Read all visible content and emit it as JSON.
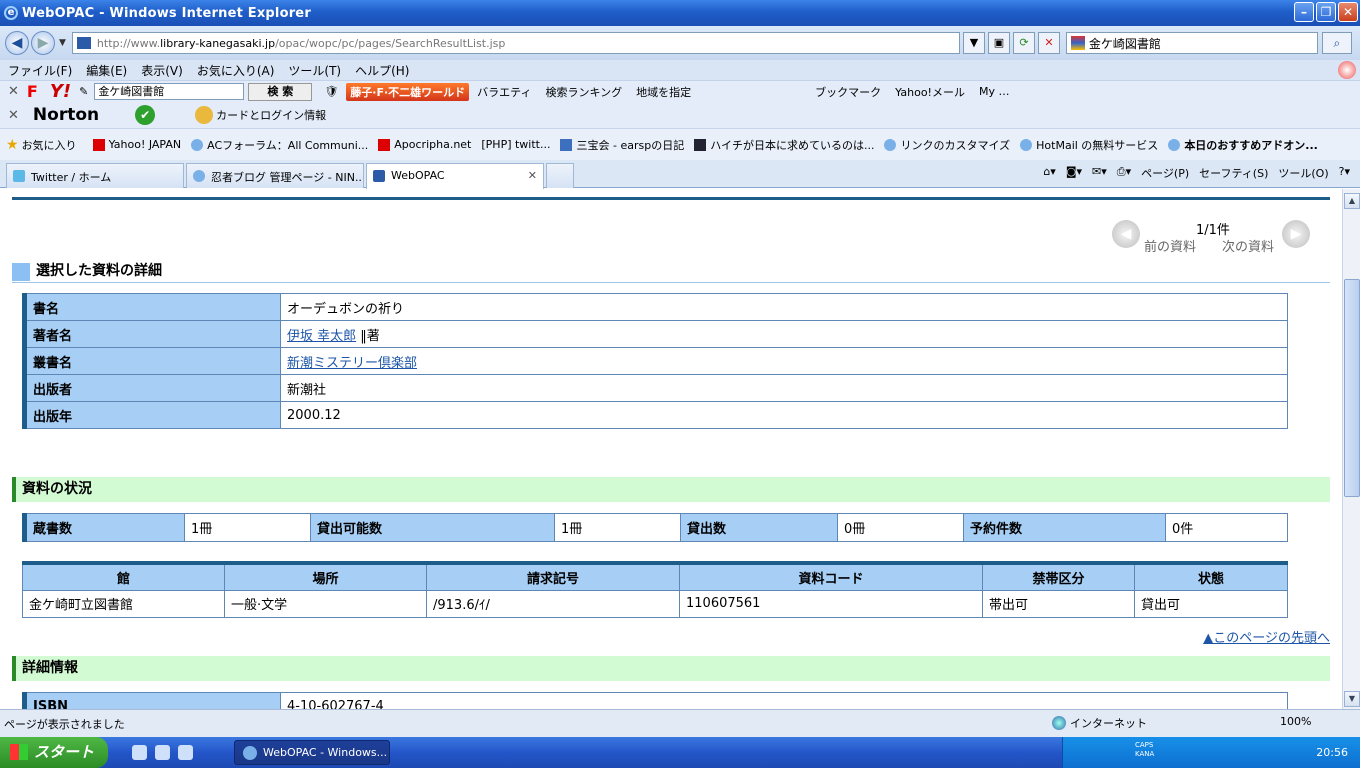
{
  "window": {
    "title": "WebOPAC - Windows Internet Explorer"
  },
  "address": {
    "url_prefix": "http://www.",
    "url_domain": "library-kanegasaki.jp",
    "url_path": "/opac/wopc/pc/pages/SearchResultList.jsp",
    "search_value": "金ケ崎図書館"
  },
  "menu": [
    "ファイル(F)",
    "編集(E)",
    "表示(V)",
    "お気に入り(A)",
    "ツール(T)",
    "ヘルプ(H)"
  ],
  "yahoo_toolbar": {
    "search_value": "金ケ崎図書館",
    "search_button": "検 索",
    "banner": "藤子·F·不二雄ワールド",
    "items": [
      "バラエティ",
      "検索ランキング",
      "地域を指定",
      "ブックマーク",
      "Yahoo!メール",
      "My …"
    ]
  },
  "norton_toolbar": {
    "brand": "Norton",
    "card_login": "カードとログイン情報"
  },
  "favorites": {
    "label": "お気に入り",
    "items": [
      "Yahoo! JAPAN",
      "ACフォーラム：All Communi...",
      "Apocripha.net",
      "[PHP] twitt...",
      "三宝会 - earspの日記",
      "ハイチが日本に求めているのは...",
      "リンクのカスタマイズ",
      "HotMail の無料サービス",
      "本日のおすすめアドオン..."
    ]
  },
  "tabs": [
    "Twitter / ホーム",
    "忍者ブログ 管理ページ - NIN...",
    "WebOPAC"
  ],
  "commands": [
    "ページ(P)",
    "セーフティ(S)",
    "ツール(O)"
  ],
  "pager": {
    "count": "1/1件",
    "prev": "前の資料",
    "next": "次の資料"
  },
  "detail": {
    "title": "選択した資料の詳細",
    "rows": [
      {
        "key": "書名",
        "value": "オーデュボンの祈り"
      },
      {
        "key": "著者名",
        "link": "伊坂 幸太郎",
        "suffix": " ‖著"
      },
      {
        "key": "叢書名",
        "link": "新潮ミステリー倶楽部"
      },
      {
        "key": "出版者",
        "value": "新潮社"
      },
      {
        "key": "出版年",
        "value": "2000.12"
      }
    ]
  },
  "status": {
    "title": "資料の状況",
    "cells": [
      {
        "key": "蔵書数",
        "value": "1冊"
      },
      {
        "key": "貸出可能数",
        "value": "1冊"
      },
      {
        "key": "貸出数",
        "value": "0冊"
      },
      {
        "key": "予約件数",
        "value": "0件"
      }
    ]
  },
  "holdings": {
    "headers": [
      "館",
      "場所",
      "請求記号",
      "資料コード",
      "禁帯区分",
      "状態"
    ],
    "rows": [
      [
        "金ケ崎町立図書館",
        "一般·文学",
        "/913.6/ｲ/",
        "110607561",
        "帯出可",
        "貸出可"
      ]
    ]
  },
  "page_top": "▲このページの先頭へ",
  "extra": {
    "title": "詳細情報",
    "isbn_key": "ISBN",
    "isbn_value": "4-10-602767-4"
  },
  "statusbar": {
    "text": "ページが表示されました",
    "zone": "インターネット",
    "zoom": "100%"
  },
  "taskbar": {
    "start": "スタート",
    "task": "WebOPAC - Windows...",
    "clock": "20:56",
    "caps": "CAPS",
    "kana": "KANA"
  }
}
